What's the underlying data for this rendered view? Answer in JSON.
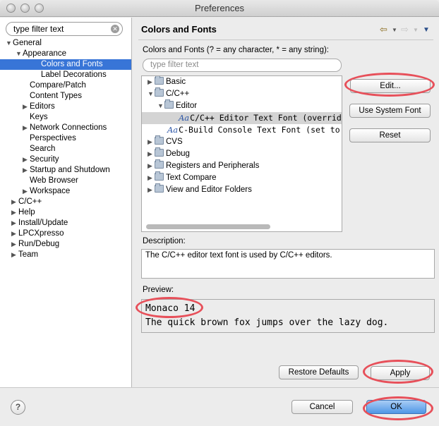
{
  "window": {
    "title": "Preferences"
  },
  "left": {
    "filter_text": "type filter text",
    "tree": [
      {
        "label": "General",
        "expanded": true
      },
      {
        "label": "Appearance",
        "expanded": true
      },
      {
        "label": "Colors and Fonts",
        "selected": true
      },
      {
        "label": "Label Decorations"
      },
      {
        "label": "Compare/Patch"
      },
      {
        "label": "Content Types"
      },
      {
        "label": "Editors",
        "expandable": true
      },
      {
        "label": "Keys"
      },
      {
        "label": "Network Connections",
        "expandable": true
      },
      {
        "label": "Perspectives"
      },
      {
        "label": "Search"
      },
      {
        "label": "Security",
        "expandable": true
      },
      {
        "label": "Startup and Shutdown",
        "expandable": true
      },
      {
        "label": "Web Browser"
      },
      {
        "label": "Workspace",
        "expandable": true
      },
      {
        "label": "C/C++",
        "expandable": true
      },
      {
        "label": "Help",
        "expandable": true
      },
      {
        "label": "Install/Update",
        "expandable": true
      },
      {
        "label": "LPCXpresso",
        "expandable": true
      },
      {
        "label": "Run/Debug",
        "expandable": true
      },
      {
        "label": "Team",
        "expandable": true
      }
    ]
  },
  "page": {
    "title": "Colors and Fonts",
    "filter_hint": "Colors and Fonts (? = any character, * = any string):",
    "filter_placeholder": "type filter text",
    "font_tree": [
      {
        "label": "Basic"
      },
      {
        "label": "C/C++"
      },
      {
        "label": "Editor"
      },
      {
        "label": "C/C++ Editor Text Font (overrid"
      },
      {
        "label": "C-Build Console Text Font (set to"
      },
      {
        "label": "CVS"
      },
      {
        "label": "Debug"
      },
      {
        "label": "Registers and Peripherals"
      },
      {
        "label": "Text Compare"
      },
      {
        "label": "View and Editor Folders"
      }
    ],
    "aa_glyph": "Aa",
    "buttons": {
      "edit": "Edit...",
      "use_system_font": "Use System Font",
      "reset": "Reset"
    },
    "description_label": "Description:",
    "description_text": "The C/C++ editor text font is used by C/C++ editors.",
    "preview_label": "Preview:",
    "preview_font": "Monaco 14",
    "preview_sample": "The quick brown fox jumps over the lazy dog.",
    "restore_defaults": "Restore Defaults",
    "apply": "Apply"
  },
  "footer": {
    "help": "?",
    "cancel": "Cancel",
    "ok": "OK"
  },
  "colors": {
    "selection": "#3875d7",
    "annotation_ring": "#e7505a",
    "default_button": "#4f96e6"
  },
  "icons": [
    "clear-search-icon",
    "back-arrow-icon",
    "forward-arrow-icon",
    "menu-dropdown-icon",
    "folder-icon",
    "font-icon",
    "help-icon"
  ]
}
